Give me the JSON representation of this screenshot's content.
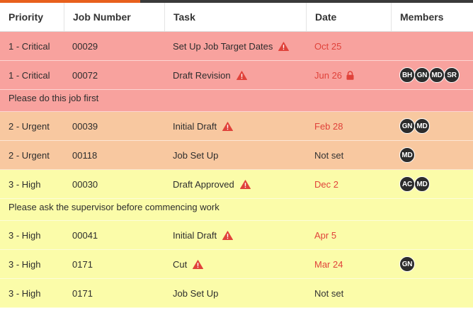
{
  "columns": [
    "Priority",
    "Job Number",
    "Task",
    "Date",
    "Members"
  ],
  "colors": {
    "critical": "#f8a29e",
    "urgent": "#f8c8a0",
    "high": "#fbfca9",
    "warning": "#e0423a",
    "avatar": "#2c2c2c",
    "accent": "#e8601c"
  },
  "rows": [
    {
      "priority": "1 - Critical",
      "job": "00029",
      "task": "Set Up Job Target Dates",
      "warning": true,
      "date": "Oct 25",
      "overdue": true,
      "locked": false,
      "members": []
    },
    {
      "priority": "1 - Critical",
      "job": "00072",
      "task": "Draft Revision",
      "warning": true,
      "date": "Jun 26",
      "overdue": true,
      "locked": true,
      "members": [
        "BH",
        "GN",
        "MD",
        "SR"
      ],
      "note": "Please do this job first"
    },
    {
      "priority": "2 - Urgent",
      "job": "00039",
      "task": "Initial Draft",
      "warning": true,
      "date": "Feb 28",
      "overdue": true,
      "locked": false,
      "members": [
        "GN",
        "MD"
      ]
    },
    {
      "priority": "2 - Urgent",
      "job": "00118",
      "task": "Job Set Up",
      "warning": false,
      "date": "Not set",
      "overdue": false,
      "locked": false,
      "members": [
        "MD"
      ]
    },
    {
      "priority": "3 - High",
      "job": "00030",
      "task": "Draft Approved",
      "warning": true,
      "date": "Dec 2",
      "overdue": true,
      "locked": false,
      "members": [
        "AC",
        "MD"
      ],
      "note": "Please ask the supervisor before commencing work"
    },
    {
      "priority": "3 - High",
      "job": "00041",
      "task": "Initial Draft",
      "warning": true,
      "date": "Apr 5",
      "overdue": true,
      "locked": false,
      "members": []
    },
    {
      "priority": "3 - High",
      "job": "0171",
      "task": "Cut",
      "warning": true,
      "date": "Mar 24",
      "overdue": true,
      "locked": false,
      "members": [
        "GN"
      ]
    },
    {
      "priority": "3 - High",
      "job": "0171",
      "task": "Job Set Up",
      "warning": false,
      "date": "Not set",
      "overdue": false,
      "locked": false,
      "members": []
    }
  ]
}
